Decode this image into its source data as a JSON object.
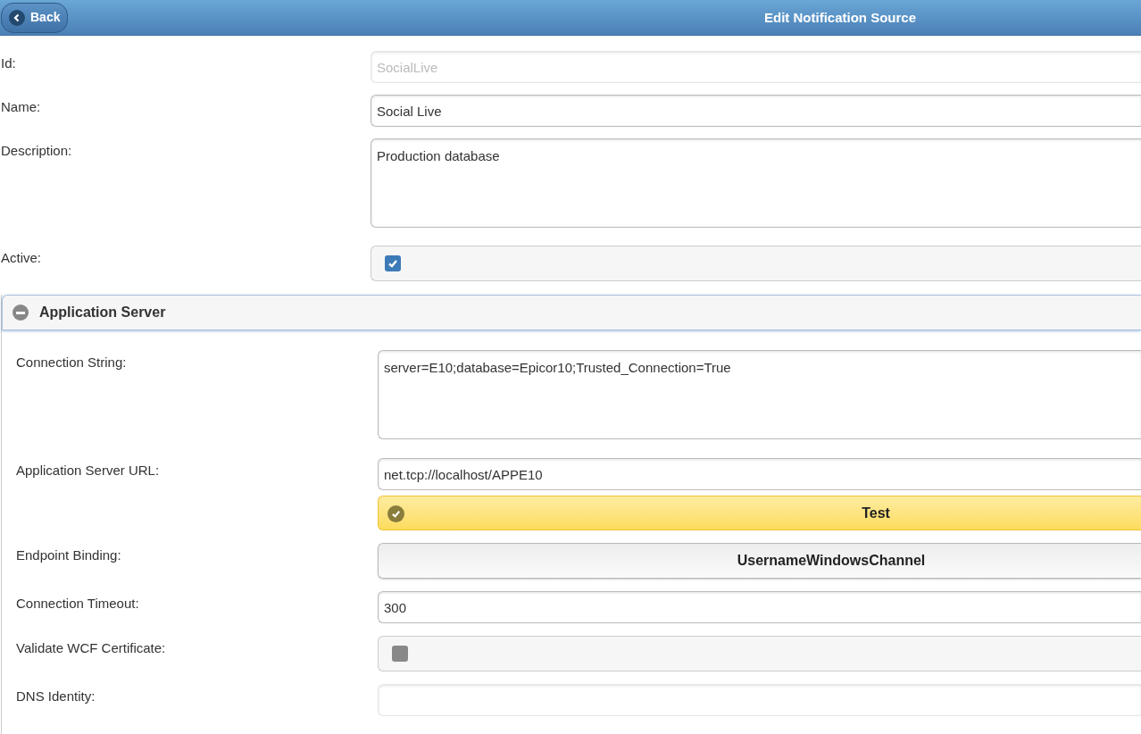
{
  "header": {
    "back_label": "Back",
    "title": "Edit Notification Source"
  },
  "fields": [
    {
      "kind": "text",
      "label": "Id:",
      "value": "SocialLive",
      "disabled": true
    },
    {
      "kind": "text",
      "label": "Name:",
      "value": "Social Live",
      "disabled": false
    },
    {
      "kind": "textarea",
      "label": "Description:",
      "value": "Production database"
    },
    {
      "kind": "checkbox",
      "label": "Active:",
      "checked": true
    }
  ],
  "section": {
    "title": "Application Server",
    "expanded": true,
    "fields": [
      {
        "kind": "textarea",
        "label": "Connection String:",
        "value": "server=E10;database=Epicor10;Trusted_Connection=True"
      },
      {
        "kind": "text",
        "label": "Application Server URL:",
        "value": "net.tcp://localhost/APPE10",
        "disabled": false,
        "button": "Test"
      },
      {
        "kind": "select",
        "label": "Endpoint Binding:",
        "value": "UsernameWindowsChannel"
      },
      {
        "kind": "text",
        "label": "Connection Timeout:",
        "value": "300",
        "disabled": false
      },
      {
        "kind": "checkbox",
        "label": "Validate WCF Certificate:",
        "checked": false
      },
      {
        "kind": "text",
        "label": "DNS Identity:",
        "disabled": true
      }
    ]
  }
}
